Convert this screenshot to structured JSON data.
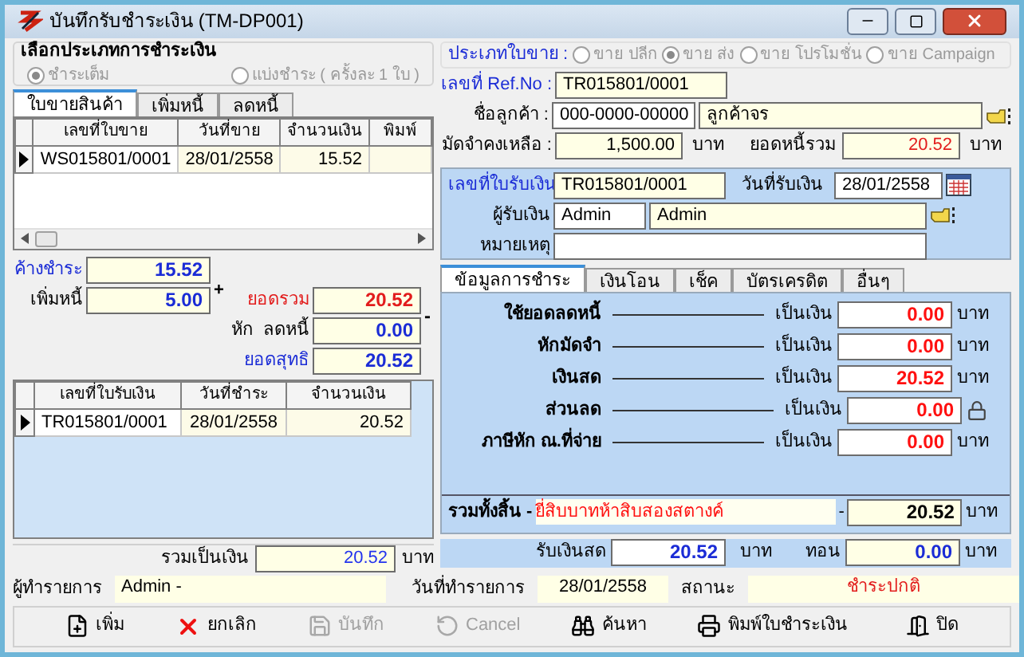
{
  "window": {
    "title": "บันทึกรับชำระเงิน (TM-DP001)"
  },
  "payment_type": {
    "title": "เลือกประเภทการชำระเงิน",
    "disabled": true,
    "options": [
      {
        "label": "ชำระเต็ม",
        "selected": true
      },
      {
        "label": "แบ่งชำระ ( ครั้งละ 1 ใบ )",
        "selected": false
      }
    ]
  },
  "doc_tabs": [
    {
      "label": "ใบขายสินค้า",
      "selected": true
    },
    {
      "label": "เพิ่มหนี้",
      "selected": false
    },
    {
      "label": "ลดหนี้",
      "selected": false
    }
  ],
  "invoice_table": {
    "columns": [
      "เลขที่ใบขาย",
      "วันที่ขาย",
      "จำนวนเงิน",
      "พิมพ์"
    ],
    "rows": [
      {
        "cells": [
          "WS015801/0001",
          "28/01/2558",
          "15.52",
          ""
        ],
        "current": true
      }
    ]
  },
  "summary": {
    "outstanding": {
      "label": "ค้างชำระ",
      "value": "15.52"
    },
    "added_debt": {
      "label": "เพิ่มหนี้",
      "value": "5.00"
    },
    "plus": "+",
    "total": {
      "label": "ยอดรวม",
      "value": "20.52"
    },
    "minus": "-",
    "deduct": {
      "label": "หัก  ลดหนี้",
      "value": "0.00"
    },
    "net": {
      "label": "ยอดสุทธิ",
      "value": "20.52"
    }
  },
  "receipt_table": {
    "columns": [
      "เลขที่ใบรับเงิน",
      "วันที่ชำระ",
      "จำนวนเงิน"
    ],
    "rows": [
      {
        "cells": [
          "TR015801/0001",
          "28/01/2558",
          "20.52"
        ],
        "current": true
      }
    ]
  },
  "total_amount": {
    "label": "รวมเป็นเงิน",
    "value": "20.52",
    "unit": "บาท"
  },
  "sale_type": {
    "label": "ประเภทใบขาย :",
    "disabled": true,
    "options": [
      {
        "label": "ขาย ปลีก",
        "selected": false
      },
      {
        "label": "ขาย ส่ง",
        "selected": true
      },
      {
        "label": "ขาย โปรโมชั่น",
        "selected": false
      },
      {
        "label": "ขาย Campaign",
        "selected": false
      }
    ]
  },
  "ref_no": {
    "label": "เลขที่ Ref.No :",
    "value": "TR015801/0001"
  },
  "customer": {
    "label": "ชื่อลูกค้า :",
    "code": "000-0000-00000",
    "name": "ลูกค้าจร"
  },
  "deposit": {
    "label": "มัดจำคงเหลือ :",
    "value": "1,500.00",
    "unit": "บาท"
  },
  "total_debt": {
    "label": "ยอดหนี้รวม",
    "value": "20.52",
    "unit": "บาท"
  },
  "receipt": {
    "number_label": "เลขที่ใบรับเงิน",
    "number": "TR015801/0001",
    "date_label": "วันที่รับเงิน",
    "date": "28/01/2558",
    "receiver_label": "ผู้รับเงิน",
    "receiver_code": "Admin",
    "receiver_name": "Admin",
    "note_label": "หมายเหตุ"
  },
  "payment_tabs": [
    {
      "label": "ข้อมูลการชำระ",
      "selected": true
    },
    {
      "label": "เงินโอน",
      "selected": false
    },
    {
      "label": "เช็ค",
      "selected": false
    },
    {
      "label": "บัตรเครดิต",
      "selected": false
    },
    {
      "label": "อื่นๆ",
      "selected": false
    }
  ],
  "payment_rows": [
    {
      "kind": "unit",
      "label": "ใช้ยอดลดหนี้",
      "amount_label": "เป็นเงิน",
      "value": "0.00",
      "unit": "บาท"
    },
    {
      "kind": "unit",
      "label": "หักมัดจำ",
      "amount_label": "เป็นเงิน",
      "value": "0.00",
      "unit": "บาท"
    },
    {
      "kind": "unit",
      "label": "เงินสด",
      "amount_label": "เป็นเงิน",
      "value": "20.52",
      "unit": "บาท"
    },
    {
      "kind": "locked",
      "label": "ส่วนลด",
      "amount_label": "เป็นเงิน",
      "value": "0.00"
    },
    {
      "kind": "unit",
      "label": "ภาษีหัก ณ.ที่จ่าย",
      "amount_label": "เป็นเงิน",
      "value": "0.00",
      "unit": "บาท"
    }
  ],
  "grand_total": {
    "label": "รวมทั้งสิ้น -",
    "words": "ยี่สิบบาทห้าสิบสองสตางค์",
    "separator": "-",
    "value": "20.52",
    "unit": "บาท"
  },
  "cash": {
    "label": "รับเงินสด",
    "value": "20.52",
    "unit": "บาท",
    "change_label": "ทอน",
    "change": "0.00",
    "change_unit": "บาท"
  },
  "footer": {
    "user_label": "ผู้ทำรายการ",
    "user": "Admin -",
    "date_label": "วันที่ทำรายการ",
    "date": "28/01/2558",
    "status_label": "สถานะ",
    "status": "ชำระปกติ"
  },
  "toolbar": [
    {
      "kind": "new",
      "label": "เพิ่ม",
      "disabled": false
    },
    {
      "kind": "cancel",
      "label": "ยกเลิก",
      "disabled": false
    },
    {
      "kind": "save",
      "label": "บันทึก",
      "disabled": true
    },
    {
      "kind": "undo",
      "label": "Cancel",
      "disabled": true
    },
    {
      "kind": "search",
      "label": "ค้นหา",
      "disabled": false
    },
    {
      "kind": "print",
      "label": "พิมพ์ใบชำระเงิน",
      "disabled": false
    },
    {
      "kind": "exit",
      "label": "ปิด",
      "disabled": false
    }
  ]
}
